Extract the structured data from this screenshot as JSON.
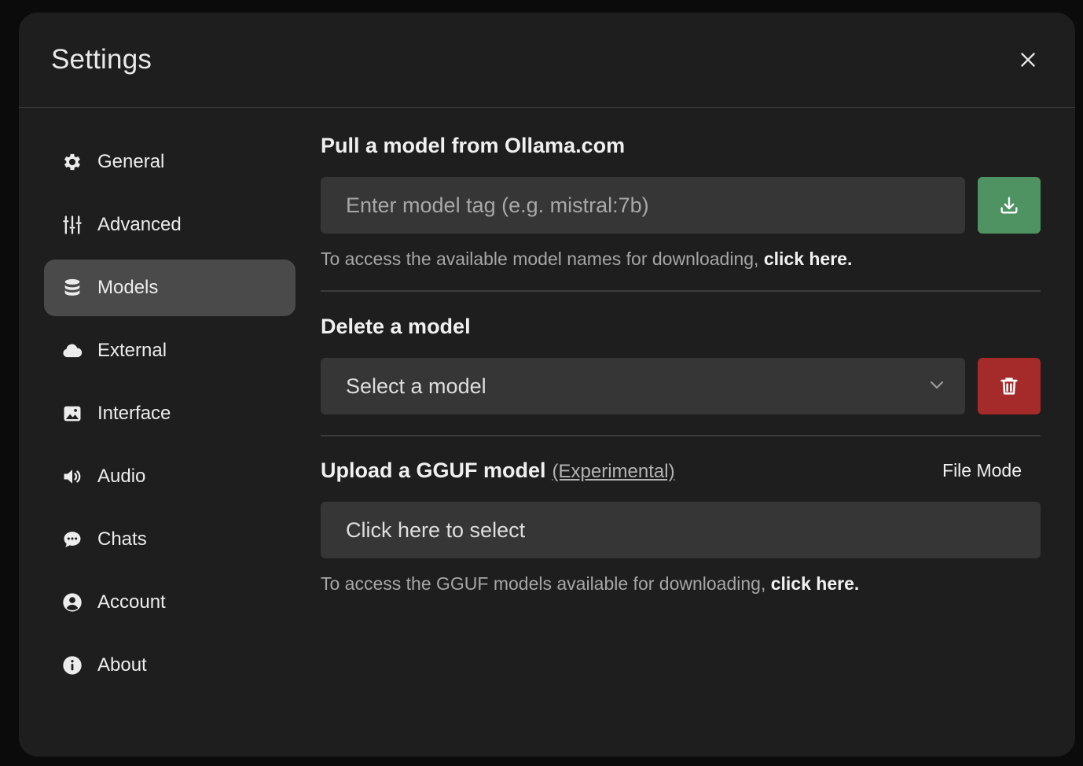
{
  "header": {
    "title": "Settings",
    "close_icon": "close-icon"
  },
  "sidebar": {
    "items": [
      {
        "label": "General",
        "icon": "gear-icon",
        "active": false
      },
      {
        "label": "Advanced",
        "icon": "sliders-icon",
        "active": false
      },
      {
        "label": "Models",
        "icon": "database-icon",
        "active": true
      },
      {
        "label": "External",
        "icon": "cloud-icon",
        "active": false
      },
      {
        "label": "Interface",
        "icon": "image-icon",
        "active": false
      },
      {
        "label": "Audio",
        "icon": "speaker-icon",
        "active": false
      },
      {
        "label": "Chats",
        "icon": "chat-bubble-icon",
        "active": false
      },
      {
        "label": "Account",
        "icon": "user-circle-icon",
        "active": false
      },
      {
        "label": "About",
        "icon": "info-icon",
        "active": false
      }
    ]
  },
  "pull": {
    "title": "Pull a model from Ollama.com",
    "placeholder": "Enter model tag (e.g. mistral:7b)",
    "value": "",
    "hint_text": "To access the available model names for downloading, ",
    "hint_link": "click here.",
    "button_icon": "download-icon",
    "button_color": "#4f9362"
  },
  "delete": {
    "title": "Delete a model",
    "select_value": "Select a model",
    "button_icon": "trash-icon",
    "button_color": "#a52a2a"
  },
  "upload": {
    "title": "Upload a GGUF model",
    "experimental": "(Experimental)",
    "mode_label": "File Mode",
    "select_label": "Click here to select",
    "hint_text": "To access the GGUF models available for downloading, ",
    "hint_link": "click here."
  }
}
